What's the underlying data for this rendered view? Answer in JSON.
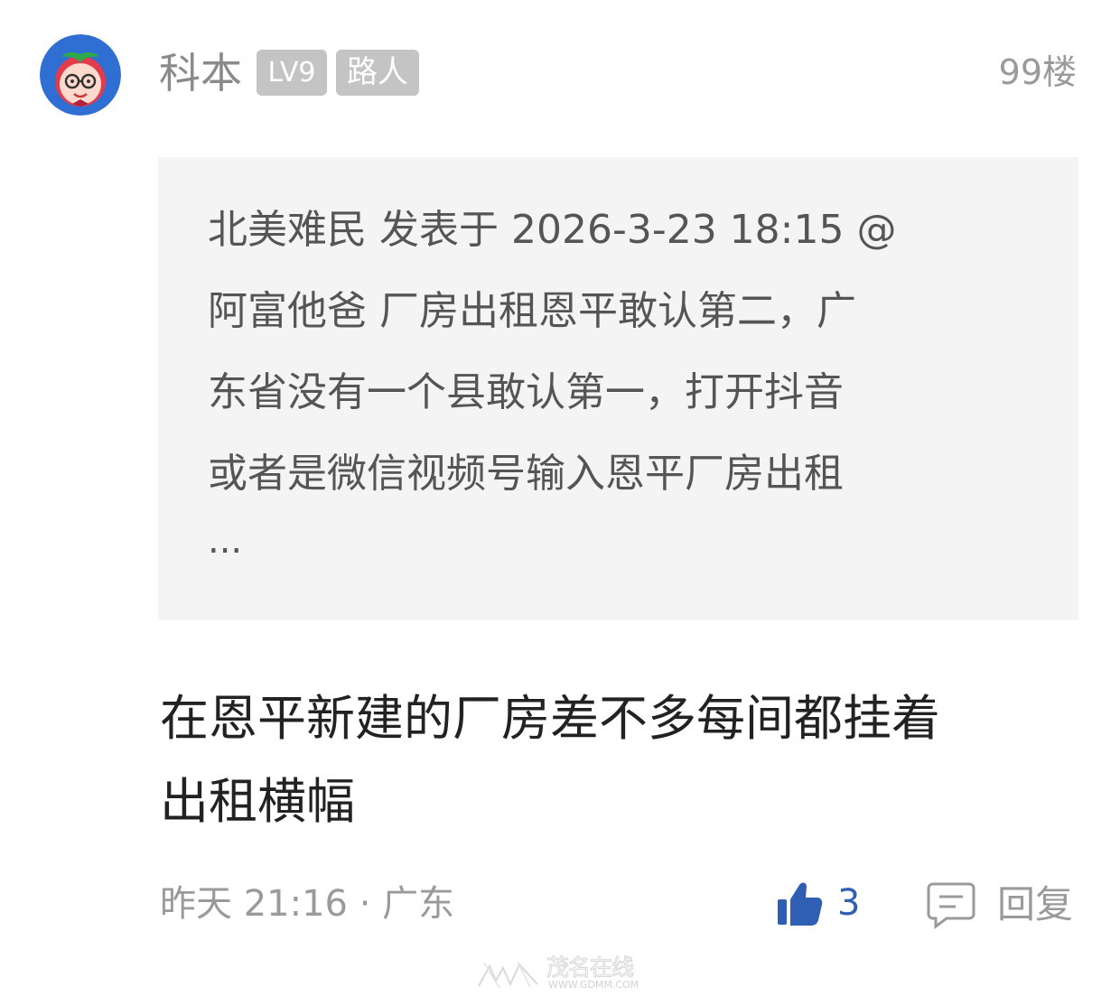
{
  "comment": {
    "username": "科本",
    "level_badge": "LV9",
    "role_badge": "路人",
    "floor": "99楼",
    "quote": {
      "lines": [
        "北美难民 发表于 2026-3-23 18:15 @",
        "阿富他爸 厂房出租恩平敢认第二，广",
        "东省没有一个县敢认第一，打开抖音",
        "或者是微信视频号输入恩平厂房出租"
      ],
      "more": "..."
    },
    "reply_lines": [
      "在恩平新建的厂房差不多每间都挂着",
      "出租横幅"
    ],
    "time": "昨天 21:16",
    "location": "广东",
    "separator": "·",
    "like_count": "3",
    "reply_label": "回复",
    "icons": {
      "avatar": "cartoon-avatar",
      "like": "thumbs-up-icon",
      "reply": "comment-icon"
    },
    "colors": {
      "like": "#2f5fb3",
      "badge": "#c4c4c4",
      "quote_background": "#f4f4f4",
      "avatar_background": "#2f6fd3"
    }
  },
  "watermark": {
    "title": "茂名在线",
    "url": "WWW.GDMM.COM"
  }
}
